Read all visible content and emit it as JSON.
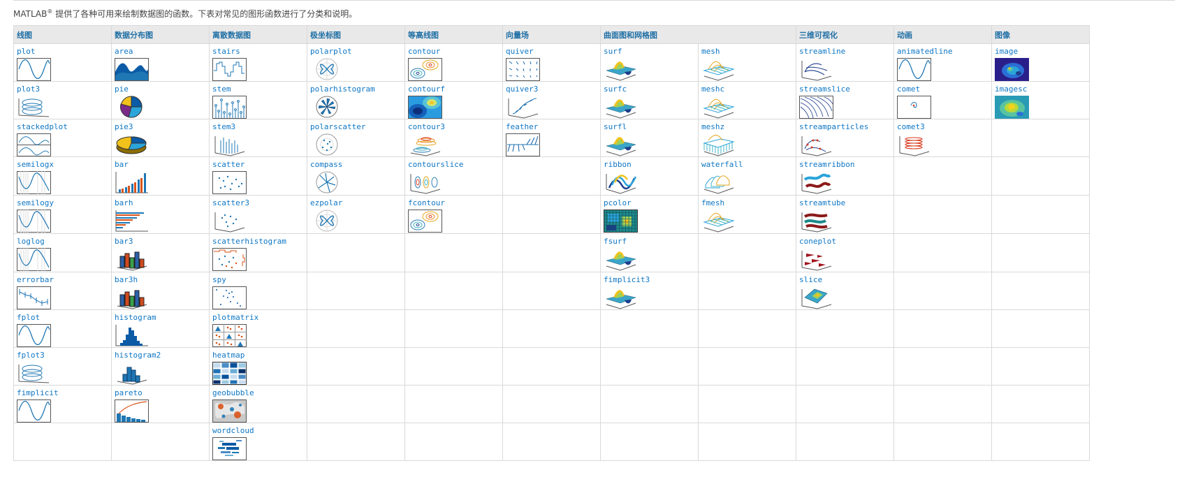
{
  "intro": {
    "brand": "MATLAB",
    "reg_mark": "®",
    "text": " 提供了各种可用来绘制数据图的函数。下表对常见的图形函数进行了分类和说明。"
  },
  "headers": {
    "line": "线图",
    "dist": "数据分布图",
    "discrete": "离散数据图",
    "polar": "极坐标图",
    "contour": "等高线图",
    "vector": "向量场",
    "surface": "曲面图和网格图",
    "vol": "三维可视化",
    "anim": "动画",
    "image": "图像"
  },
  "fn": {
    "plot": "plot",
    "plot3": "plot3",
    "stackedplot": "stackedplot",
    "semilogx": "semilogx",
    "semilogy": "semilogy",
    "loglog": "loglog",
    "errorbar": "errorbar",
    "fplot": "fplot",
    "fplot3": "fplot3",
    "fimplicit": "fimplicit",
    "area": "area",
    "pie": "pie",
    "pie3": "pie3",
    "bar": "bar",
    "barh": "barh",
    "bar3": "bar3",
    "bar3h": "bar3h",
    "histogram": "histogram",
    "histogram2": "histogram2",
    "pareto": "pareto",
    "stairs": "stairs",
    "stem": "stem",
    "stem3": "stem3",
    "scatter": "scatter",
    "scatter3": "scatter3",
    "scatterhistogram": "scatterhistogram",
    "spy": "spy",
    "plotmatrix": "plotmatrix",
    "heatmap": "heatmap",
    "geobubble": "geobubble",
    "wordcloud": "wordcloud",
    "polarplot": "polarplot",
    "polarhistogram": "polarhistogram",
    "polarscatter": "polarscatter",
    "compass": "compass",
    "ezpolar": "ezpolar",
    "contour": "contour",
    "contourf": "contourf",
    "contour3": "contour3",
    "contourslice": "contourslice",
    "fcontour": "fcontour",
    "quiver": "quiver",
    "quiver3": "quiver3",
    "feather": "feather",
    "surf": "surf",
    "surfc": "surfc",
    "surfl": "surfl",
    "ribbon": "ribbon",
    "pcolor": "pcolor",
    "fsurf": "fsurf",
    "fimplicit3": "fimplicit3",
    "mesh": "mesh",
    "meshc": "meshc",
    "meshz": "meshz",
    "waterfall": "waterfall",
    "fmesh": "fmesh",
    "streamline": "streamline",
    "streamslice": "streamslice",
    "streamparticles": "streamparticles",
    "streamribbon": "streamribbon",
    "streamtube": "streamtube",
    "coneplot": "coneplot",
    "slice": "slice",
    "animatedline": "animatedline",
    "comet": "comet",
    "comet3": "comet3",
    "image": "image",
    "imagesc": "imagesc"
  }
}
